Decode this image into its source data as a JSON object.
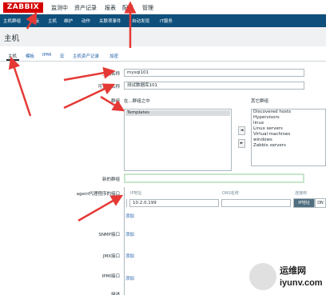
{
  "app": {
    "logo": "ZABBIX"
  },
  "main_menu": [
    "监测中",
    "资产记录",
    "报表",
    "配置",
    "管理"
  ],
  "sub_menu": [
    "主机群组",
    "模板",
    "主机",
    "维护",
    "动作",
    "关联项事件",
    "自动发现",
    "IT服务"
  ],
  "page": {
    "title": "主机"
  },
  "tabs": [
    "主机",
    "模板",
    "IPMI",
    "宏",
    "主机资产记录",
    "加密"
  ],
  "form": {
    "hostname_label": "主机名称",
    "hostname_value": "mysql101",
    "visible_name_label": "可见的名称",
    "visible_name_value": "测试数据库101",
    "groups_label": "群组",
    "in_groups_label": "在...群组之中",
    "in_groups": [
      "Templates"
    ],
    "other_groups_label": "其它群组",
    "other_groups": [
      "Discovered hosts",
      "Hypervisors",
      "linux",
      "Linux servers",
      "Virtual machines",
      "windows",
      "Zabbix servers"
    ],
    "move_left": "◄",
    "move_right": "►",
    "new_group_label": "新的群组",
    "agent_label": "agent代理程序的接口",
    "ip_col": "IP地址",
    "dns_col": "DNS名称",
    "connect_col": "连接到",
    "ip_value": "10.2.0.199",
    "connect_ip": "IP地址",
    "connect_dns": "DN",
    "add_label": "添加",
    "snmp_label": "SNMP接口",
    "jmx_label": "JMX接口",
    "ipmi_label": "IPMI接口",
    "desc_label": "描述"
  },
  "watermark": {
    "line1": "运维网",
    "line2": "iyunv.com"
  },
  "colors": {
    "brand": "#d40000",
    "nav": "#0e4f7b",
    "annotation": "#e53935"
  }
}
